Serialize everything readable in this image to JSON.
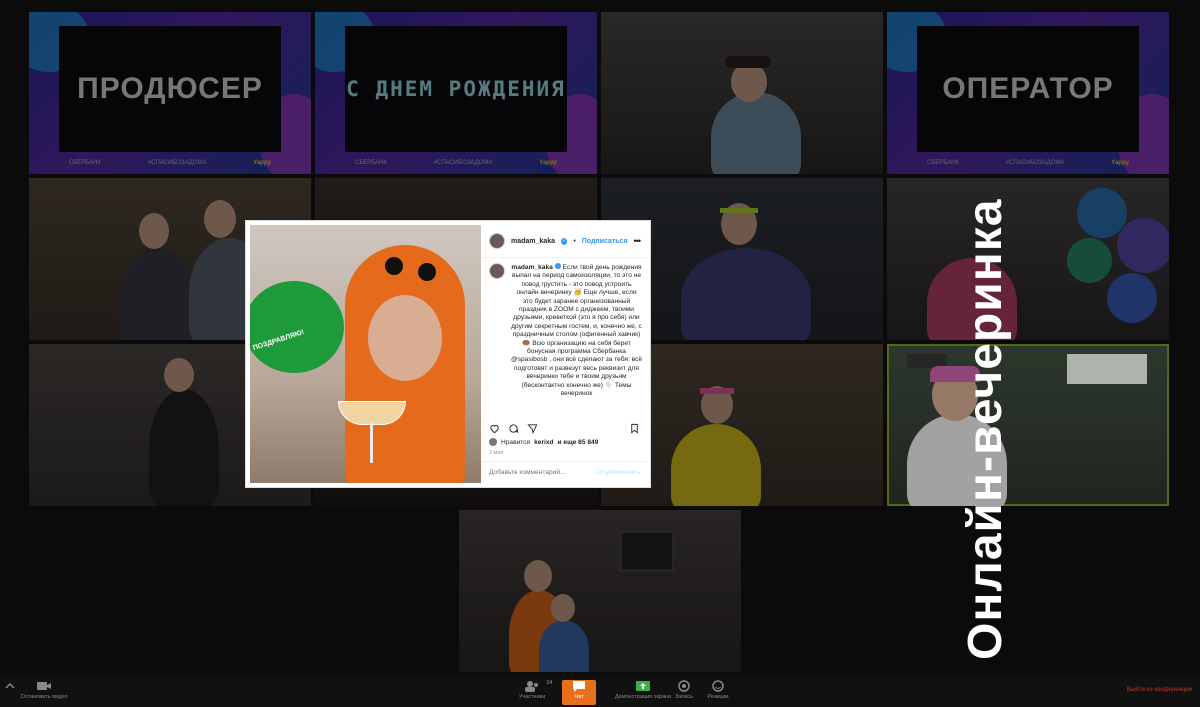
{
  "tiles": {
    "producer_label": "ПРОДЮСЕР",
    "birthday_label": "С ДНЕМ РОЖДЕНИЯ",
    "operator_label": "ОПЕРАТОР",
    "brand_footer_left": "СБЕРБАНК",
    "brand_footer_mid": "#СПАСИБОЗАДОМА",
    "brand_footer_right": "Yappy"
  },
  "instagram": {
    "username": "madam_kaka",
    "follow": "Подписаться",
    "caption_user": "madam_kaka",
    "caption": "Если твой день рождения выпал на период самоизоляции, то это не повод грустить - это повод устроить онлайн вечеринку 🥳 Еще лучше, если это будет заранее организованный праздник в ZOOM с диджеем, твоими друзьями, креветкой (это я про себя) или другим секретным гостем, и, конечно же, с праздничным столом (офигенный хавчик) 🍩 Всю организацию на себя берет бонусная программа Сбербанка @spasibosb , они всё сделают за тебя: всё подготовят и развезут весь реквизит для вечеринки тебе и твоим друзьям (бесконтактно конечно же) 👇🏻 Темы вечеринок",
    "likes_prefix": "Нравится",
    "likes_user": "kerixd",
    "likes_suffix": "и еще 85 849",
    "date": "2 мая",
    "comment_placeholder": "Добавьте комментарий...",
    "publish": "Опубликовать",
    "balloon_text": "ПОЗДРАВЛЯЮ!"
  },
  "title": "Онлайн-вечеринка",
  "toolbar": {
    "video": "Остановить видео",
    "participants": "Участники",
    "participants_count": "14",
    "chat": "Чат",
    "share": "Демонстрация экрана",
    "record": "Запись",
    "reactions": "Реакции",
    "end": "Выйти из конференции"
  },
  "colors": {
    "active_outline": "#6b8e1f",
    "chat_highlight": "#e8701b",
    "ig_blue": "#3897f0",
    "balloon": "#1f9a3a"
  }
}
